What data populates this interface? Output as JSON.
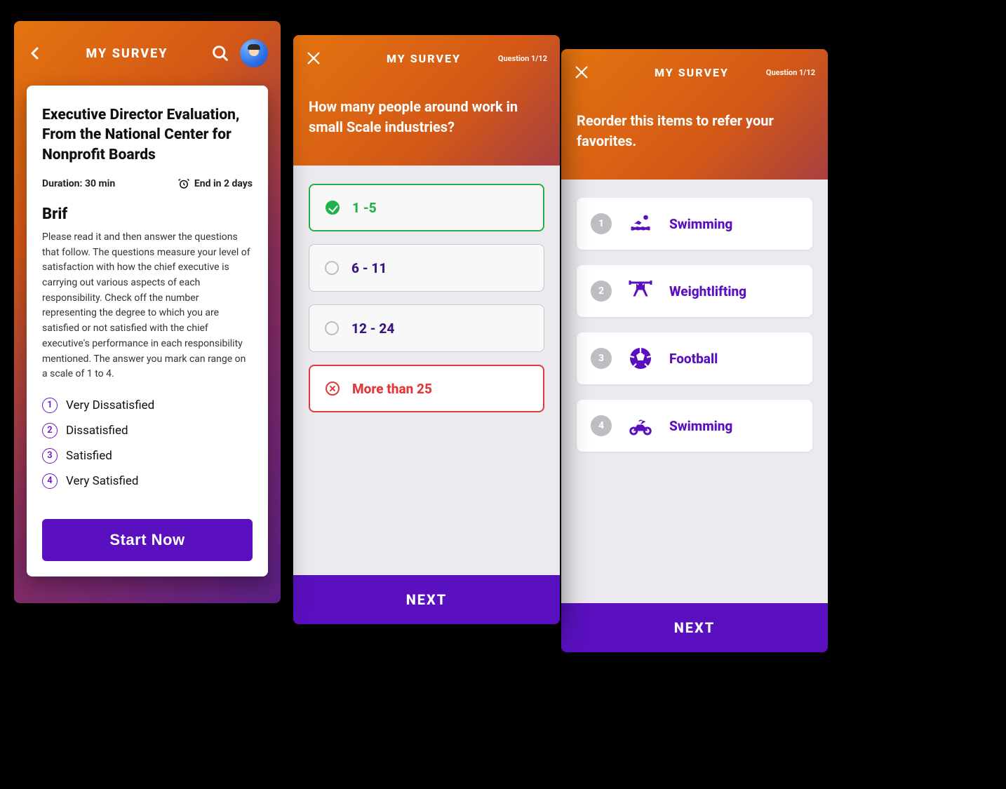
{
  "screen1": {
    "header_title": "MY SURVEY",
    "card": {
      "title": "Executive Director Evaluation, From the National Center for Nonprofit Boards",
      "duration_label": "Duration: 30 min",
      "end_label": "End in 2 days",
      "brief_heading": "Brif",
      "brief_text": "Please read it and then answer the questions that follow. The questions measure your level of satisfaction with how the chief executive is carrying out various aspects of each responsibility. Check off the number representing the degree to which you are satisfied or not satisfied with the chief executive's performance in each responsibility mentioned. The answer you mark can range on a scale of 1 to 4.",
      "scale": [
        {
          "n": "1",
          "label": "Very Dissatisfied"
        },
        {
          "n": "2",
          "label": "Dissatisfied"
        },
        {
          "n": "3",
          "label": "Satisfied"
        },
        {
          "n": "4",
          "label": "Very Satisfied"
        }
      ],
      "start_label": "Start Now"
    }
  },
  "screen2": {
    "header_title": "MY SURVEY",
    "counter": "Question 1/12",
    "question": "How many people around work in small Scale industries?",
    "options": [
      {
        "label": "1 -5",
        "state": "selected"
      },
      {
        "label": "6 - 11",
        "state": "normal"
      },
      {
        "label": "12 - 24",
        "state": "normal"
      },
      {
        "label": "More than 25",
        "state": "wrong"
      }
    ],
    "next_label": "NEXT"
  },
  "screen3": {
    "header_title": "MY SURVEY",
    "counter": "Question 1/12",
    "question": "Reorder this items to refer your favorites.",
    "items": [
      {
        "n": "1",
        "label": "Swimming",
        "icon": "swimming-icon"
      },
      {
        "n": "2",
        "label": "Weightlifting",
        "icon": "weightlifting-icon"
      },
      {
        "n": "3",
        "label": "Football",
        "icon": "football-icon"
      },
      {
        "n": "4",
        "label": "Swimming",
        "icon": "motorcycle-icon"
      }
    ],
    "next_label": "NEXT"
  }
}
